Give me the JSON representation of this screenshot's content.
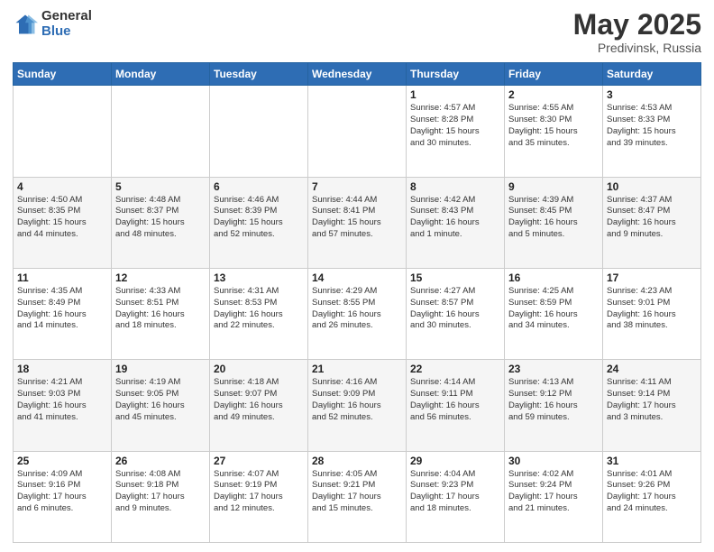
{
  "logo": {
    "general": "General",
    "blue": "Blue"
  },
  "title": {
    "month": "May 2025",
    "location": "Predivinsk, Russia"
  },
  "weekdays": [
    "Sunday",
    "Monday",
    "Tuesday",
    "Wednesday",
    "Thursday",
    "Friday",
    "Saturday"
  ],
  "weeks": [
    [
      {
        "day": "",
        "info": ""
      },
      {
        "day": "",
        "info": ""
      },
      {
        "day": "",
        "info": ""
      },
      {
        "day": "",
        "info": ""
      },
      {
        "day": "1",
        "info": "Sunrise: 4:57 AM\nSunset: 8:28 PM\nDaylight: 15 hours\nand 30 minutes."
      },
      {
        "day": "2",
        "info": "Sunrise: 4:55 AM\nSunset: 8:30 PM\nDaylight: 15 hours\nand 35 minutes."
      },
      {
        "day": "3",
        "info": "Sunrise: 4:53 AM\nSunset: 8:33 PM\nDaylight: 15 hours\nand 39 minutes."
      }
    ],
    [
      {
        "day": "4",
        "info": "Sunrise: 4:50 AM\nSunset: 8:35 PM\nDaylight: 15 hours\nand 44 minutes."
      },
      {
        "day": "5",
        "info": "Sunrise: 4:48 AM\nSunset: 8:37 PM\nDaylight: 15 hours\nand 48 minutes."
      },
      {
        "day": "6",
        "info": "Sunrise: 4:46 AM\nSunset: 8:39 PM\nDaylight: 15 hours\nand 52 minutes."
      },
      {
        "day": "7",
        "info": "Sunrise: 4:44 AM\nSunset: 8:41 PM\nDaylight: 15 hours\nand 57 minutes."
      },
      {
        "day": "8",
        "info": "Sunrise: 4:42 AM\nSunset: 8:43 PM\nDaylight: 16 hours\nand 1 minute."
      },
      {
        "day": "9",
        "info": "Sunrise: 4:39 AM\nSunset: 8:45 PM\nDaylight: 16 hours\nand 5 minutes."
      },
      {
        "day": "10",
        "info": "Sunrise: 4:37 AM\nSunset: 8:47 PM\nDaylight: 16 hours\nand 9 minutes."
      }
    ],
    [
      {
        "day": "11",
        "info": "Sunrise: 4:35 AM\nSunset: 8:49 PM\nDaylight: 16 hours\nand 14 minutes."
      },
      {
        "day": "12",
        "info": "Sunrise: 4:33 AM\nSunset: 8:51 PM\nDaylight: 16 hours\nand 18 minutes."
      },
      {
        "day": "13",
        "info": "Sunrise: 4:31 AM\nSunset: 8:53 PM\nDaylight: 16 hours\nand 22 minutes."
      },
      {
        "day": "14",
        "info": "Sunrise: 4:29 AM\nSunset: 8:55 PM\nDaylight: 16 hours\nand 26 minutes."
      },
      {
        "day": "15",
        "info": "Sunrise: 4:27 AM\nSunset: 8:57 PM\nDaylight: 16 hours\nand 30 minutes."
      },
      {
        "day": "16",
        "info": "Sunrise: 4:25 AM\nSunset: 8:59 PM\nDaylight: 16 hours\nand 34 minutes."
      },
      {
        "day": "17",
        "info": "Sunrise: 4:23 AM\nSunset: 9:01 PM\nDaylight: 16 hours\nand 38 minutes."
      }
    ],
    [
      {
        "day": "18",
        "info": "Sunrise: 4:21 AM\nSunset: 9:03 PM\nDaylight: 16 hours\nand 41 minutes."
      },
      {
        "day": "19",
        "info": "Sunrise: 4:19 AM\nSunset: 9:05 PM\nDaylight: 16 hours\nand 45 minutes."
      },
      {
        "day": "20",
        "info": "Sunrise: 4:18 AM\nSunset: 9:07 PM\nDaylight: 16 hours\nand 49 minutes."
      },
      {
        "day": "21",
        "info": "Sunrise: 4:16 AM\nSunset: 9:09 PM\nDaylight: 16 hours\nand 52 minutes."
      },
      {
        "day": "22",
        "info": "Sunrise: 4:14 AM\nSunset: 9:11 PM\nDaylight: 16 hours\nand 56 minutes."
      },
      {
        "day": "23",
        "info": "Sunrise: 4:13 AM\nSunset: 9:12 PM\nDaylight: 16 hours\nand 59 minutes."
      },
      {
        "day": "24",
        "info": "Sunrise: 4:11 AM\nSunset: 9:14 PM\nDaylight: 17 hours\nand 3 minutes."
      }
    ],
    [
      {
        "day": "25",
        "info": "Sunrise: 4:09 AM\nSunset: 9:16 PM\nDaylight: 17 hours\nand 6 minutes."
      },
      {
        "day": "26",
        "info": "Sunrise: 4:08 AM\nSunset: 9:18 PM\nDaylight: 17 hours\nand 9 minutes."
      },
      {
        "day": "27",
        "info": "Sunrise: 4:07 AM\nSunset: 9:19 PM\nDaylight: 17 hours\nand 12 minutes."
      },
      {
        "day": "28",
        "info": "Sunrise: 4:05 AM\nSunset: 9:21 PM\nDaylight: 17 hours\nand 15 minutes."
      },
      {
        "day": "29",
        "info": "Sunrise: 4:04 AM\nSunset: 9:23 PM\nDaylight: 17 hours\nand 18 minutes."
      },
      {
        "day": "30",
        "info": "Sunrise: 4:02 AM\nSunset: 9:24 PM\nDaylight: 17 hours\nand 21 minutes."
      },
      {
        "day": "31",
        "info": "Sunrise: 4:01 AM\nSunset: 9:26 PM\nDaylight: 17 hours\nand 24 minutes."
      }
    ]
  ]
}
